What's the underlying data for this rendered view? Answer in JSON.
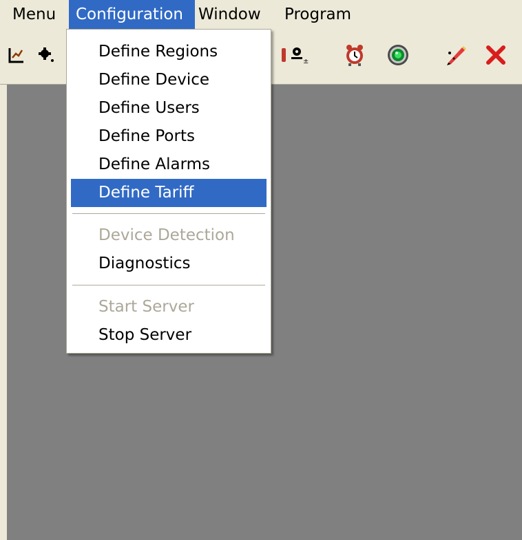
{
  "menubar": {
    "items": [
      "Menu",
      "Configuration",
      "Window",
      "Program"
    ],
    "active": "Configuration"
  },
  "toolbar": {
    "buttons": [
      {
        "icon": "graph-icon"
      },
      {
        "icon": "gear-icon"
      },
      {
        "icon": "partial-icon"
      },
      {
        "icon": "user-add-icon"
      },
      {
        "icon": "alarm-clock-icon"
      },
      {
        "icon": "green-target-icon"
      },
      {
        "icon": "edit-pencil-icon"
      },
      {
        "icon": "close-x-icon"
      }
    ]
  },
  "dropdown": {
    "items": [
      {
        "label": "Define Regions",
        "enabled": true
      },
      {
        "label": "Define Device",
        "enabled": true
      },
      {
        "label": "Define Users",
        "enabled": true
      },
      {
        "label": "Define Ports",
        "enabled": true
      },
      {
        "label": "Define Alarms",
        "enabled": true
      },
      {
        "label": "Define Tariff",
        "enabled": true,
        "selected": true
      },
      {
        "label": "Device Detection",
        "enabled": false
      },
      {
        "label": "Diagnostics",
        "enabled": true
      },
      {
        "label": "Start Server",
        "enabled": false
      },
      {
        "label": "Stop Server",
        "enabled": true
      }
    ]
  },
  "colors": {
    "highlight": "#316ac5",
    "workspace": "#808080",
    "chrome": "#ece9d8",
    "disabled_text": "#aca899"
  }
}
